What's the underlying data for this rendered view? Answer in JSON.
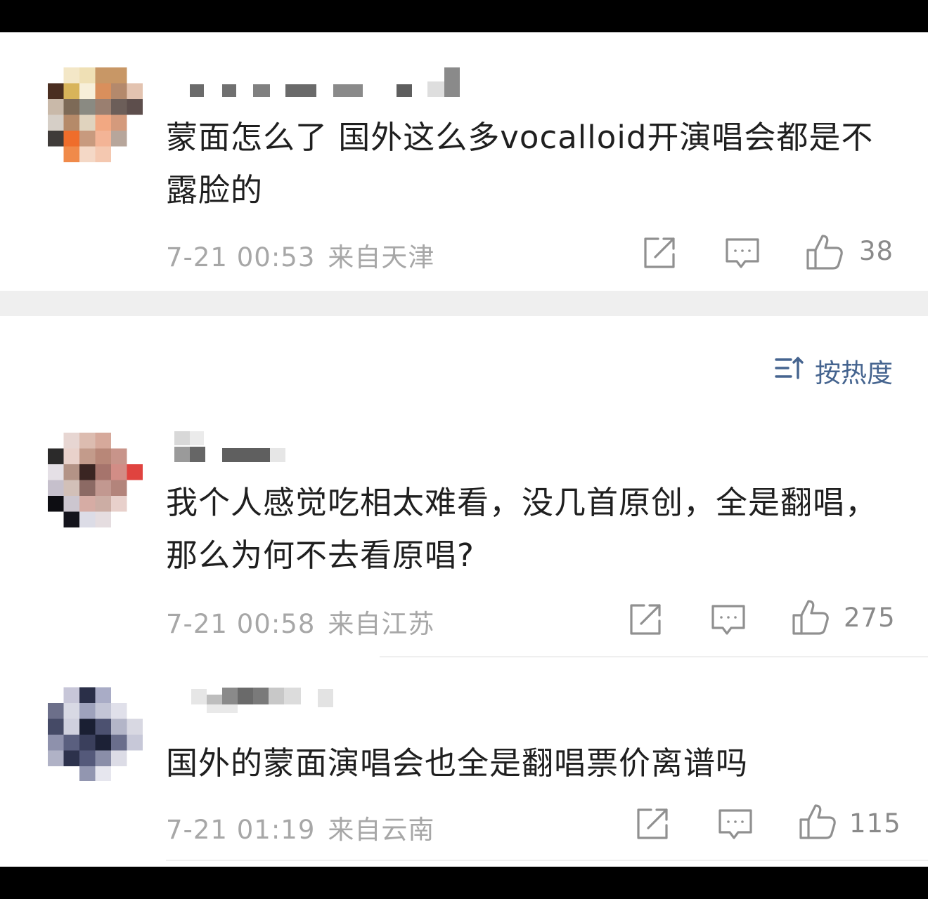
{
  "comments": [
    {
      "text": "蒙面怎么了 国外这么多vocalloid开演唱会都是不露脸的",
      "date": "7-21 00:53",
      "location": "来自天津",
      "likes": "38"
    },
    {
      "text": "我个人感觉吃相太难看，没几首原创，全是翻唱，那么为何不去看原唱?",
      "date": "7-21 00:58",
      "location": "来自江苏",
      "likes": "275"
    },
    {
      "text": "国外的蒙面演唱会也全是翻唱票价离谱吗",
      "date": "7-21 01:19",
      "location": "来自云南",
      "likes": "115"
    }
  ],
  "sort": {
    "label": "按热度"
  },
  "icons": {
    "sort": "sort-icon",
    "share": "share-icon",
    "reply": "comment-icon",
    "like": "thumbs-up-icon"
  },
  "colors": {
    "text": "#1f1f1f",
    "meta": "#a7a7a7",
    "accent": "#45648f",
    "separator": "#efefef"
  }
}
